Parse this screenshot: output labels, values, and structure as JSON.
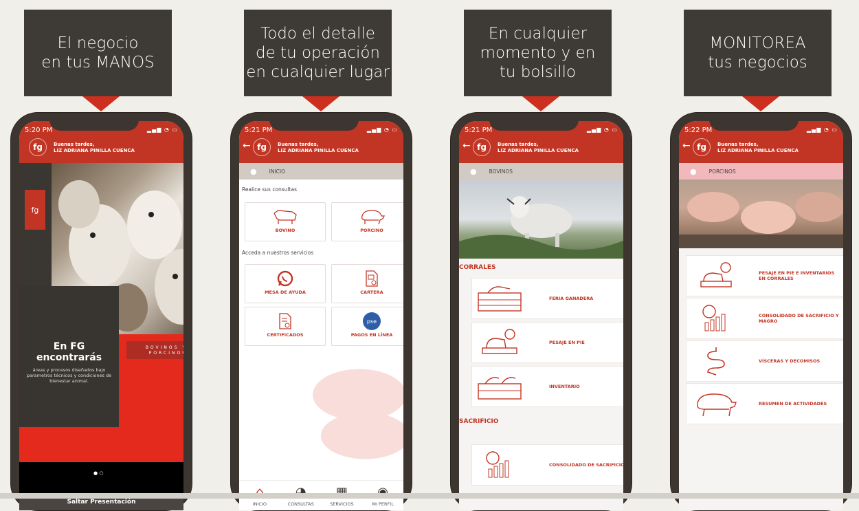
{
  "panels": [
    {
      "caption_lines": [
        "El negocio",
        "en tus MANOS"
      ],
      "status_time": "5:20 PM",
      "greeting_line1": "Buenas tardes,",
      "greeting_line2": "LIZ ADRIANA PINILLA CUENCA",
      "logo_text": "fg",
      "promo_title": "En FG encontrarás",
      "promo_text": "áreas y procesos diseñados bajo parametros técnicos y condiciones de bienestar animal.",
      "tag_text": "BOVINOS Y PORCINOS",
      "skip_label": "Saltar Presentación"
    },
    {
      "caption_lines": [
        "Todo el detalle",
        "de tu operación",
        "en cualquier lugar"
      ],
      "status_time": "5:21 PM",
      "greeting_line1": "Buenas tardes,",
      "greeting_line2": "LIZ ADRIANA PINILLA CUENCA",
      "logo_text": "fg",
      "crumb": "INICIO",
      "section1": "Realice sus consultas",
      "section2": "Acceda a nuestros servicios",
      "cards": [
        "BOVINO",
        "PORCINO",
        "MESA DE AYUDA",
        "CARTERA",
        "CERTIFICADOS",
        "PAGOS EN LÍNEA"
      ],
      "pse_label": "pse",
      "tabs": [
        "INICIO",
        "CONSULTAS",
        "SERVICIOS",
        "MI PERFIL"
      ]
    },
    {
      "caption_lines": [
        "En cualquier",
        "momento y en",
        "tu bolsillo"
      ],
      "status_time": "5:21 PM",
      "greeting_line1": "Buenas tardes,",
      "greeting_line2": "LIZ ADRIANA PINILLA CUENCA",
      "logo_text": "fg",
      "crumb": "BOVINOS",
      "category1": "CORRALES",
      "items1": [
        "FERIA GANADERA",
        "PESAJE EN PIE",
        "INVENTARIO"
      ],
      "category2": "SACRIFICIO",
      "items2": [
        "CONSOLIDADO DE SACRIFICIO"
      ]
    },
    {
      "caption_lines": [
        "MONITOREA",
        "tus negocios"
      ],
      "status_time": "5:22 PM",
      "greeting_line1": "Buenas tardes,",
      "greeting_line2": "LIZ ADRIANA PINILLA CUENCA",
      "logo_text": "fg",
      "crumb": "PORCINOS",
      "items": [
        "PESAJE EN PIE E INVENTARIOS EN CORRALES",
        "CONSOLIDADO DE SACRIFICIO Y MAGRO",
        "VÍSCERAS Y DECOMISOS",
        "RESUMEN DE ACTIVIDADES"
      ]
    }
  ],
  "colors": {
    "brand_red": "#c23524",
    "caption_bg": "#3e3a35",
    "phone_frame": "#3d3530"
  },
  "icons": [
    "home-icon",
    "pie-chart-icon",
    "grid-icon",
    "user-icon",
    "whatsapp-icon",
    "document-icon",
    "certificate-icon",
    "back-arrow-icon",
    "location-pin-icon"
  ]
}
